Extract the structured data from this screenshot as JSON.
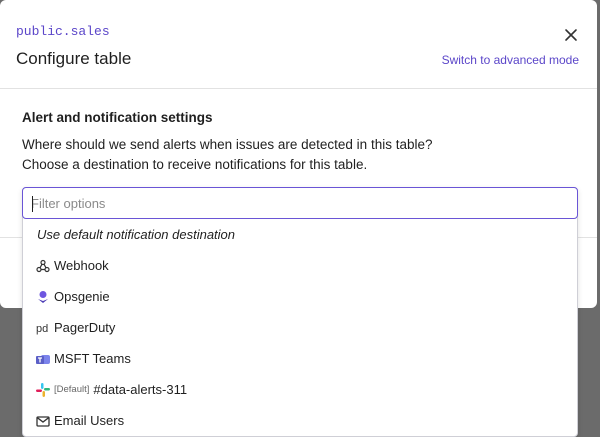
{
  "modal": {
    "schema_name": "public.sales",
    "title": "Configure table",
    "advanced_link": "Switch to advanced mode"
  },
  "section": {
    "title": "Alert and notification settings",
    "line1": "Where should we send alerts when issues are detected in this table?",
    "line2": "Choose a destination to receive notifications for this table."
  },
  "filter": {
    "placeholder": "Filter options",
    "value": ""
  },
  "options": [
    {
      "label": "Use default notification destination",
      "icon": "none"
    },
    {
      "label": "Webhook",
      "icon": "webhook-icon"
    },
    {
      "label": "Opsgenie",
      "icon": "opsgenie-icon"
    },
    {
      "label": "PagerDuty",
      "icon": "pagerduty-icon"
    },
    {
      "label": "MSFT Teams",
      "icon": "msft-teams-icon"
    },
    {
      "label": "#data-alerts-311",
      "tag": "[Default]",
      "icon": "slack-icon"
    },
    {
      "label": "Email Users",
      "icon": "mail-icon"
    }
  ],
  "colors": {
    "accent": "#5b46c9",
    "opsgenie": "#6e56e0",
    "teams": "#5b5fc7"
  }
}
